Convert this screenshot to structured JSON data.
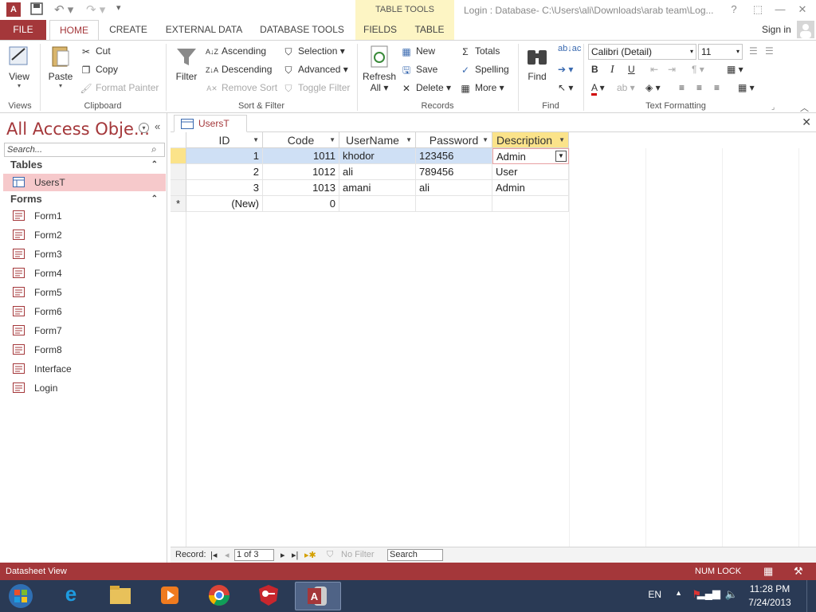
{
  "titlebar": {
    "app_icon": "A",
    "title": "Login : Database- C:\\Users\\ali\\Downloads\\arab team\\Log...",
    "contextual_group": "TABLE TOOLS",
    "buttons": [
      "?",
      "—",
      "❐",
      "✕"
    ]
  },
  "tabs": {
    "file": "FILE",
    "home": "HOME",
    "create": "CREATE",
    "external_data": "EXTERNAL DATA",
    "database_tools": "DATABASE TOOLS",
    "fields": "FIELDS",
    "table": "TABLE",
    "sign_in": "Sign in"
  },
  "ribbon": {
    "views": {
      "label": "Views",
      "view": "View"
    },
    "clipboard": {
      "label": "Clipboard",
      "paste": "Paste",
      "cut": "Cut",
      "copy": "Copy",
      "format_painter": "Format Painter"
    },
    "sort_filter": {
      "label": "Sort & Filter",
      "filter": "Filter",
      "ascending": "Ascending",
      "descending": "Descending",
      "remove_sort": "Remove Sort",
      "selection": "Selection",
      "advanced": "Advanced",
      "toggle_filter": "Toggle Filter"
    },
    "records": {
      "label": "Records",
      "refresh": "Refresh",
      "refresh_all": "All",
      "new": "New",
      "save": "Save",
      "delete": "Delete",
      "totals": "Totals",
      "spelling": "Spelling",
      "more": "More"
    },
    "find": {
      "label": "Find",
      "find": "Find"
    },
    "text_formatting": {
      "label": "Text Formatting",
      "font": "Calibri (Detail)",
      "size": "11",
      "bold": "B",
      "italic": "I",
      "underline": "U"
    }
  },
  "nav": {
    "title": "All Access Obje...",
    "search_placeholder": "Search...",
    "tables_section": "Tables",
    "tables": [
      "UsersT"
    ],
    "forms_section": "Forms",
    "forms": [
      "Form1",
      "Form2",
      "Form3",
      "Form4",
      "Form5",
      "Form6",
      "Form7",
      "Form8",
      "Interface",
      "Login"
    ]
  },
  "document": {
    "tab": "UsersT",
    "columns": [
      "ID",
      "Code",
      "UserName",
      "Password",
      "Description"
    ],
    "rows": [
      {
        "id": "1",
        "code": "1011",
        "username": "khodor",
        "password": "123456",
        "description": "Admin"
      },
      {
        "id": "2",
        "code": "1012",
        "username": "ali",
        "password": "789456",
        "description": "User"
      },
      {
        "id": "3",
        "code": "1013",
        "username": "amani",
        "password": "ali",
        "description": "Admin"
      }
    ],
    "new_row": {
      "id": "(New)",
      "code": "0"
    }
  },
  "record_bar": {
    "label": "Record:",
    "position": "1 of 3",
    "no_filter": "No Filter",
    "search": "Search"
  },
  "status": {
    "view": "Datasheet View",
    "num_lock": "NUM LOCK"
  },
  "taskbar": {
    "language": "EN",
    "time": "11:28 PM",
    "date": "7/24/2013"
  },
  "colors": {
    "accent": "#a4373a",
    "selected_row": "#cfe0f5",
    "selected_header": "#fbe38a",
    "nav_selected": "#f6c9cb"
  }
}
